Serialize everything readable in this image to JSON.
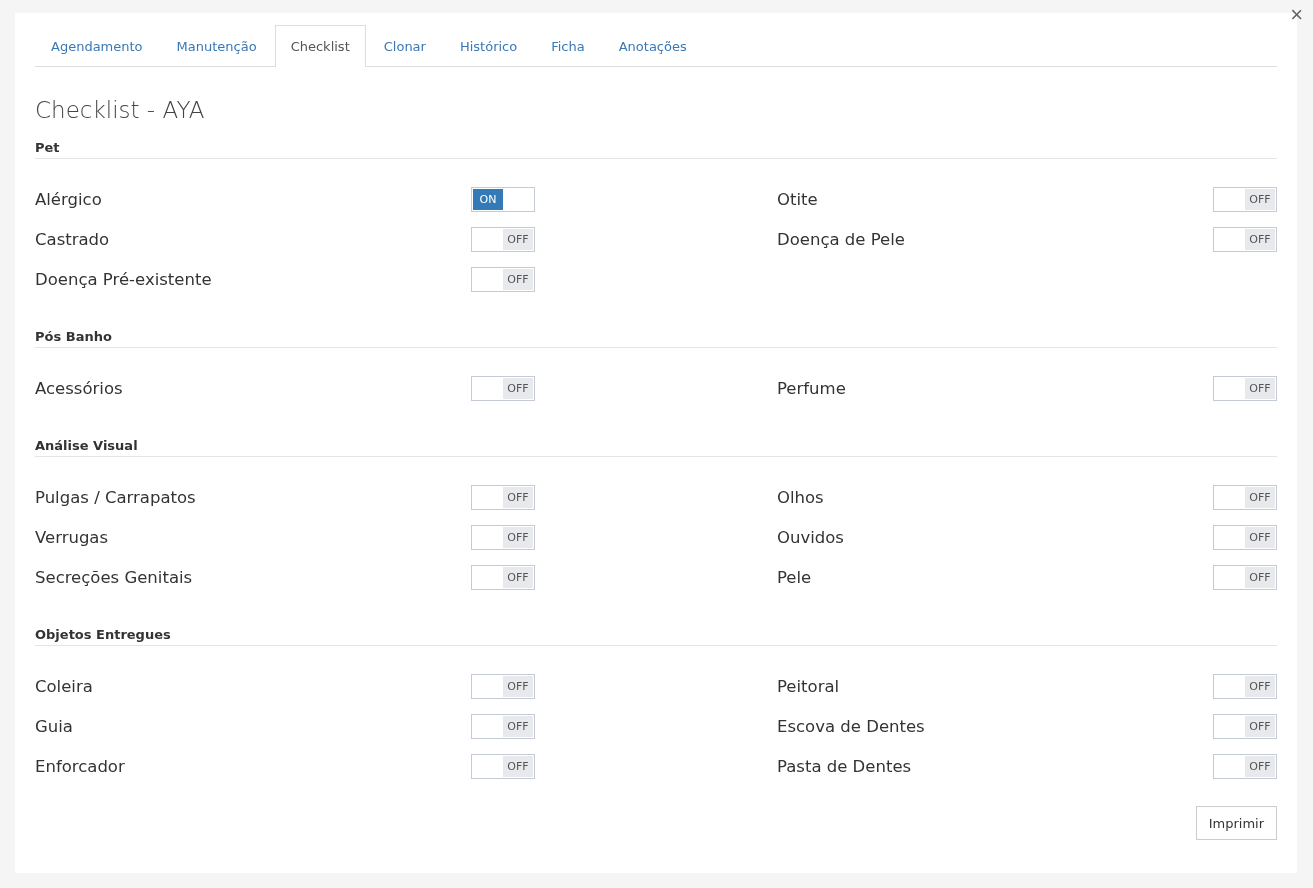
{
  "close_button": "×",
  "tabs": [
    {
      "label": "Agendamento",
      "selected": false
    },
    {
      "label": "Manutenção",
      "selected": false
    },
    {
      "label": "Checklist",
      "selected": true
    },
    {
      "label": "Clonar",
      "selected": false
    },
    {
      "label": "Histórico",
      "selected": false
    },
    {
      "label": "Ficha",
      "selected": false
    },
    {
      "label": "Anotações",
      "selected": false
    }
  ],
  "heading": "Checklist - AYA",
  "sections": [
    {
      "title": "Pet",
      "items": [
        {
          "label": "Alérgico",
          "on": true,
          "switch_text": "ON"
        },
        {
          "label": "Otite",
          "on": false,
          "switch_text": "OFF"
        },
        {
          "label": "Castrado",
          "on": false,
          "switch_text": "OFF"
        },
        {
          "label": "Doença de Pele",
          "on": false,
          "switch_text": "OFF"
        },
        {
          "label": "Doença Pré-existente",
          "on": false,
          "switch_text": "OFF"
        }
      ]
    },
    {
      "title": "Pós Banho",
      "items": [
        {
          "label": "Acessórios",
          "on": false,
          "switch_text": "OFF"
        },
        {
          "label": "Perfume",
          "on": false,
          "switch_text": "OFF"
        }
      ]
    },
    {
      "title": "Análise Visual",
      "items": [
        {
          "label": "Pulgas / Carrapatos",
          "on": false,
          "switch_text": "OFF"
        },
        {
          "label": "Olhos",
          "on": false,
          "switch_text": "OFF"
        },
        {
          "label": "Verrugas",
          "on": false,
          "switch_text": "OFF"
        },
        {
          "label": "Ouvidos",
          "on": false,
          "switch_text": "OFF"
        },
        {
          "label": "Secreções Genitais",
          "on": false,
          "switch_text": "OFF"
        },
        {
          "label": "Pele",
          "on": false,
          "switch_text": "OFF"
        }
      ]
    },
    {
      "title": "Objetos Entregues",
      "items": [
        {
          "label": "Coleira",
          "on": false,
          "switch_text": "OFF"
        },
        {
          "label": "Peitoral",
          "on": false,
          "switch_text": "OFF"
        },
        {
          "label": "Guia",
          "on": false,
          "switch_text": "OFF"
        },
        {
          "label": "Escova de Dentes",
          "on": false,
          "switch_text": "OFF"
        },
        {
          "label": "Enforcador",
          "on": false,
          "switch_text": "OFF"
        },
        {
          "label": "Pasta de Dentes",
          "on": false,
          "switch_text": "OFF"
        }
      ]
    }
  ],
  "print_button": "Imprimir"
}
